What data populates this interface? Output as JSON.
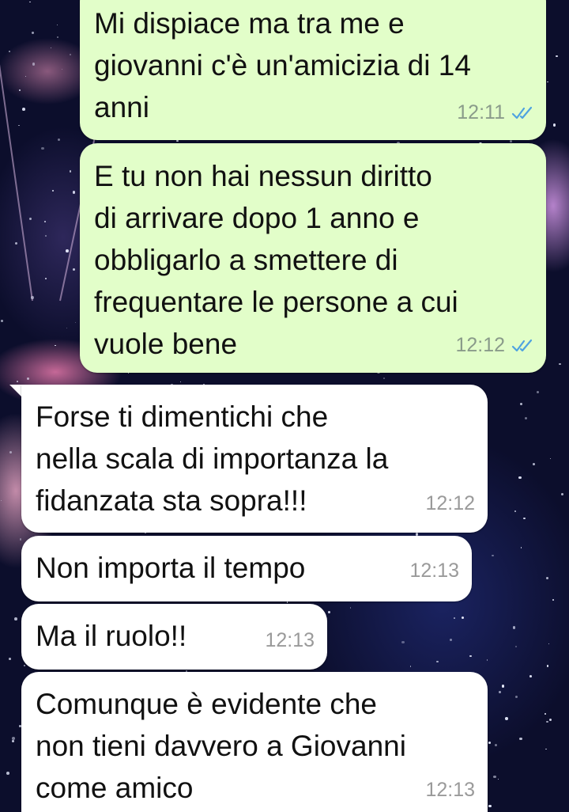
{
  "messages": [
    {
      "direction": "outgoing",
      "text": "Mi dispiace ma tra me e\ngiovanni c'è un'amicizia di 14\nanni",
      "time": "12:11",
      "read": true
    },
    {
      "direction": "outgoing",
      "text": "E tu non hai nessun diritto\ndi arrivare dopo 1 anno e\nobbligarlo a smettere di\nfrequentare le persone a cui\nvuole bene",
      "time": "12:12",
      "read": true
    },
    {
      "direction": "incoming",
      "text": "Forse ti dimentichi che\nnella scala di importanza la\nfidanzata sta sopra!!!",
      "time": "12:12"
    },
    {
      "direction": "incoming",
      "text": "Non importa il tempo",
      "time": "12:13"
    },
    {
      "direction": "incoming",
      "text": "Ma il ruolo!!",
      "time": "12:13"
    },
    {
      "direction": "incoming",
      "text": "Comunque è evidente che\nnon tieni davvero a Giovanni\ncome amico",
      "time": "12:13"
    }
  ],
  "colors": {
    "outgoing_bubble": "#e2fec9",
    "incoming_bubble": "#ffffff",
    "read_ticks": "#4fa3e0"
  },
  "icons": {
    "read_receipt": "double-check-icon"
  }
}
